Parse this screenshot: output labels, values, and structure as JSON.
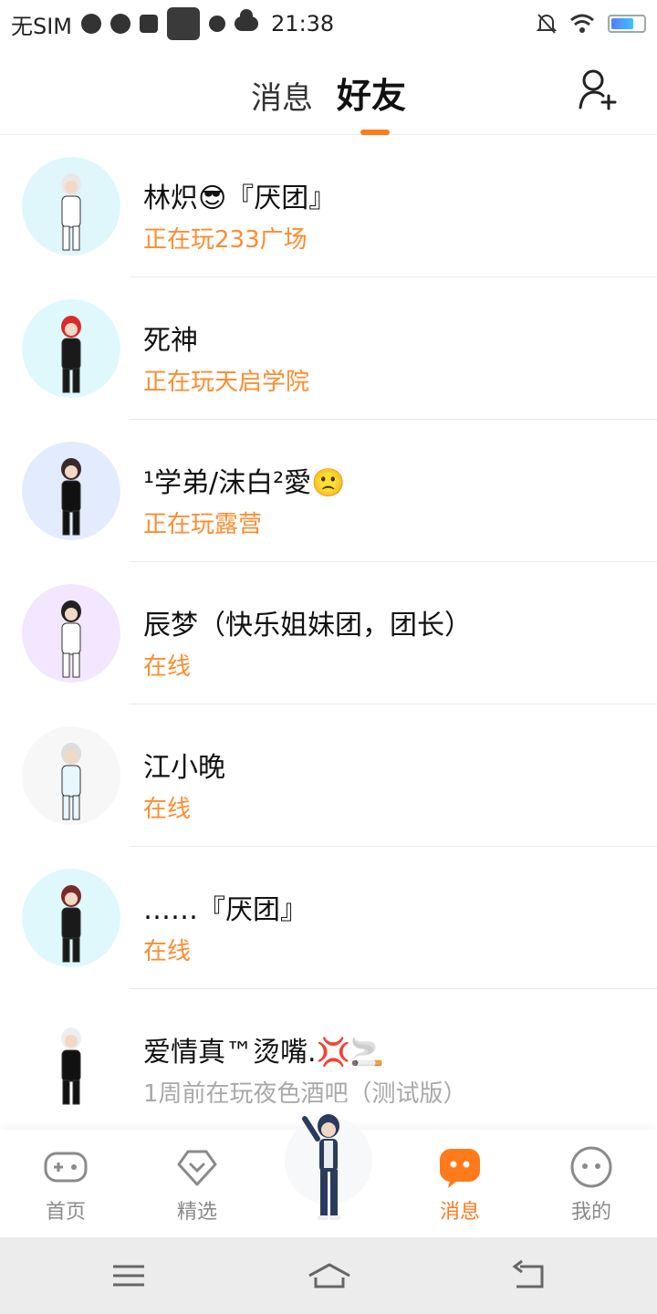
{
  "status_bar": {
    "carrier": "无SIM",
    "time": "21:38"
  },
  "header": {
    "tabs": [
      {
        "label": "消息",
        "active": false
      },
      {
        "label": "好友",
        "active": true
      }
    ],
    "add_friend_icon": "add-user-icon",
    "accent_color": "#ff7a1a"
  },
  "friends": [
    {
      "name": "林炽😎『厌团』",
      "status": "正在玩233广场",
      "status_style": "orange",
      "avatar_bg": "#dff7fb"
    },
    {
      "name": "死神",
      "status": "正在玩天启学院",
      "status_style": "orange",
      "avatar_bg": "#dff8fb"
    },
    {
      "name": "¹学弟/沫白²愛🙁",
      "status": "正在玩露营",
      "status_style": "orange",
      "avatar_bg": "#e3ecff"
    },
    {
      "name": "辰梦（快乐姐妹团，团长）",
      "status": "在线",
      "status_style": "orange",
      "avatar_bg": "#f3e6ff"
    },
    {
      "name": "江小晚",
      "status": "在线",
      "status_style": "orange",
      "avatar_bg": "#f7f7f7"
    },
    {
      "name": "……『厌团』",
      "status": "在线",
      "status_style": "orange",
      "avatar_bg": "#dff8fb"
    },
    {
      "name": "爱情真™烫嘴.💢🚬",
      "status": "1周前在玩夜色酒吧（测试版）",
      "status_style": "gray",
      "avatar_bg": "#ffffff"
    }
  ],
  "bottom_nav": {
    "items": [
      {
        "label": "首页",
        "icon": "gamepad-icon",
        "active": false
      },
      {
        "label": "精选",
        "icon": "heart-diamond-icon",
        "active": false
      },
      {
        "label": "消息",
        "icon": "chat-bubble-icon",
        "active": true
      },
      {
        "label": "我的",
        "icon": "face-icon",
        "active": false
      }
    ]
  },
  "system_nav": {
    "icons": [
      "menu-icon",
      "home-icon",
      "back-icon"
    ]
  }
}
